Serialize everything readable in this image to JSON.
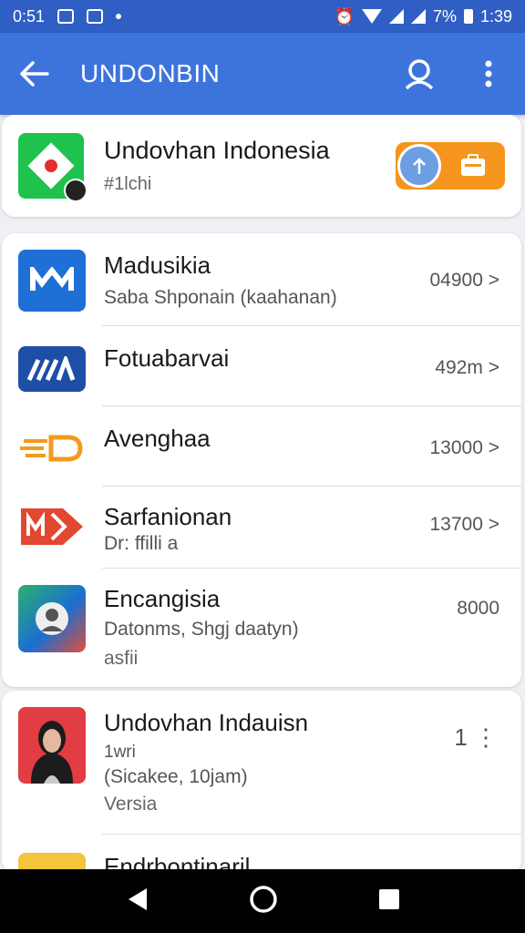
{
  "status_bar": {
    "time_left": "0:51",
    "battery_text": "7%",
    "clock": "1:39"
  },
  "app_bar": {
    "title": "UNDONBIN"
  },
  "featured": {
    "title": "Undovhan Indonesia",
    "subtitle": "#1lchi"
  },
  "list": [
    {
      "title": "Madusikia",
      "subtitle": "Saba Shponain (kaahanan)",
      "value": "04900 >"
    },
    {
      "title": "Fotuabarvai",
      "subtitle": "",
      "value": "492m >"
    },
    {
      "title": "Avenghaa",
      "subtitle": "",
      "value": "13000 >"
    },
    {
      "title": "Sarfanionan",
      "subtitle": "Dr: ffilli a",
      "value": "13700 >"
    },
    {
      "title": "Encangisia",
      "subtitle": "Datonms, Shgj daatyn)",
      "extra": "asfii",
      "value": "8000"
    }
  ],
  "bottom": [
    {
      "title": "Undovhan Indauisn",
      "line1": "1wri",
      "line2": "(Sicakee, 10jam)",
      "line3": "Versia",
      "value": "1 ⋮"
    },
    {
      "title": "Endrbontinaril"
    }
  ],
  "colors": {
    "status": "#2f5fc4",
    "appbar": "#3d74dc",
    "accent_orange": "#f6951e",
    "green": "#1fc24d"
  }
}
